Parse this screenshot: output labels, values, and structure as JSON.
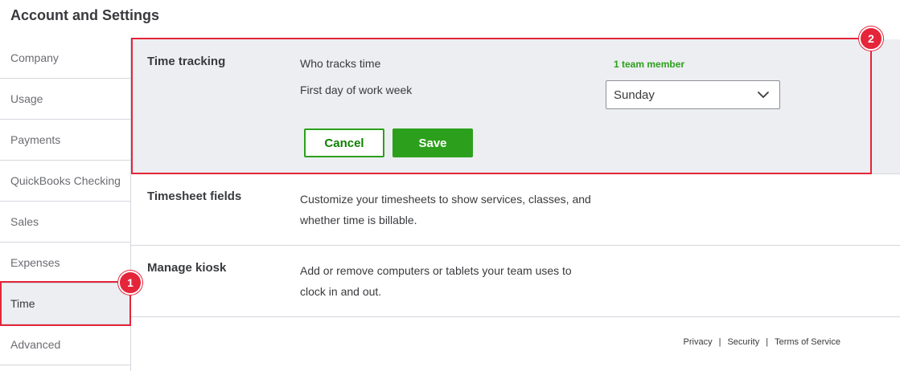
{
  "page": {
    "title": "Account and Settings"
  },
  "sidebar": {
    "items": [
      {
        "label": "Company"
      },
      {
        "label": "Usage"
      },
      {
        "label": "Payments"
      },
      {
        "label": "QuickBooks Checking"
      },
      {
        "label": "Sales"
      },
      {
        "label": "Expenses"
      },
      {
        "label": "Time",
        "active": true
      },
      {
        "label": "Advanced"
      }
    ]
  },
  "callouts": {
    "one": "1",
    "two": "2"
  },
  "time_tracking": {
    "title": "Time tracking",
    "who_tracks_label": "Who tracks time",
    "who_tracks_value": "1 team member",
    "first_day_label": "First day of work week",
    "first_day_value": "Sunday",
    "cancel_label": "Cancel",
    "save_label": "Save"
  },
  "timesheet_fields": {
    "title": "Timesheet fields",
    "description": "Customize your timesheets to show services, classes, and whether time is billable."
  },
  "manage_kiosk": {
    "title": "Manage kiosk",
    "description": "Add or remove computers or tablets your team uses to clock in and out."
  },
  "footer": {
    "privacy": "Privacy",
    "security": "Security",
    "terms": "Terms of Service",
    "separator": "|"
  },
  "colors": {
    "accent_green": "#2ca01c",
    "callout_red": "#e4253a",
    "panel_bg": "#eceef1"
  }
}
